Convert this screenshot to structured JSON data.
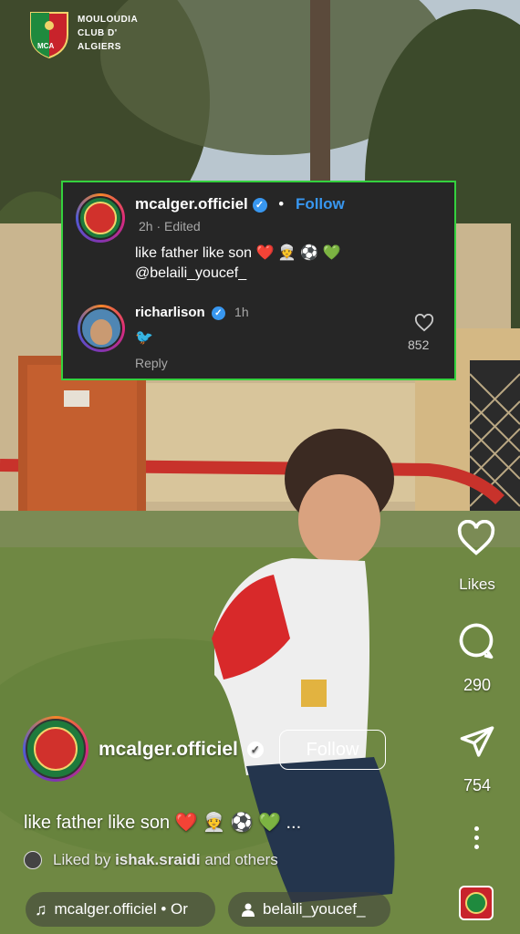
{
  "watermark": {
    "logo_text": "MCA",
    "club_line1": "MOULOUDIA",
    "club_line2": "CLUB D'",
    "club_line3": "ALGIERS"
  },
  "comment_card": {
    "author": "mcalger.officiel",
    "separator": "•",
    "follow_label": "Follow",
    "meta": "2h · Edited",
    "text_line1": "like father like son ❤️ 👳 ⚽ 💚",
    "text_line2": "@belaili_youcef_",
    "reply": {
      "author": "richarlison",
      "time": "1h",
      "text": "🐦",
      "reply_label": "Reply",
      "like_count": "852"
    }
  },
  "rail": {
    "likes_label": "Likes",
    "comments_count": "290",
    "shares_count": "754"
  },
  "post": {
    "username": "mcalger.officiel",
    "follow_label": "Follow",
    "caption": "like father like son ❤️ 👳 ⚽ 💚",
    "caption_more": "...",
    "liked_by_prefix": "Liked by",
    "liked_by_user": "ishak.sraidi",
    "liked_by_suffix": "and others",
    "audio": "mcalger.officiel • Or",
    "tagged_user": "belaili_youcef_"
  },
  "colors": {
    "card_border": "#34d13e",
    "card_bg": "#262626",
    "follow_blue": "#3897f0",
    "verified_blue": "#3897f0"
  },
  "icons": [
    "heart-icon",
    "comment-icon",
    "send-icon",
    "more-icon",
    "music-icon",
    "person-icon",
    "verified-icon"
  ]
}
